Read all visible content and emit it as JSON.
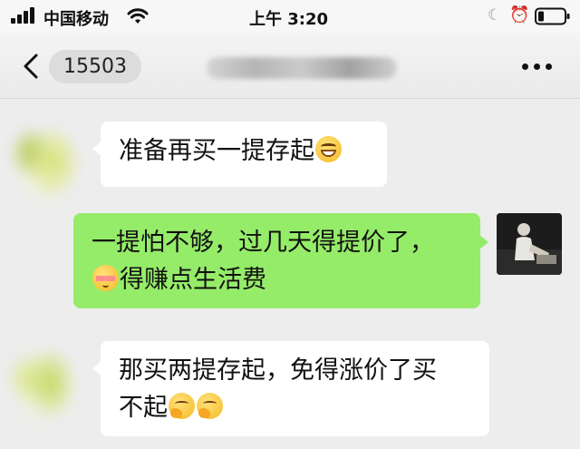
{
  "status_bar": {
    "carrier": "中国移动",
    "time": "上午 3:20",
    "icons": [
      "signal-icon",
      "wifi-icon",
      "moon-icon",
      "alarm-icon",
      "battery-icon"
    ]
  },
  "nav": {
    "back_icon": "chevron-left-icon",
    "count": "15503",
    "more_icon": "more-dots-icon"
  },
  "messages": [
    {
      "side": "left",
      "text": "准备再买一提存起",
      "emoji": [
        "grinning-face"
      ]
    },
    {
      "side": "right",
      "text_line1": "一提怕不够，过几天得提价了，",
      "text_line2": "得赚点生活费",
      "emoji": [
        "shy-face"
      ]
    },
    {
      "side": "left",
      "text_line1": "那买两提存起，免得涨价了买",
      "text_line2": "不起",
      "emoji": [
        "thinking-face",
        "thinking-face"
      ]
    }
  ],
  "colors": {
    "chat_background": "#ededed",
    "incoming_bubble": "#ffffff",
    "outgoing_bubble": "#95ec69"
  }
}
